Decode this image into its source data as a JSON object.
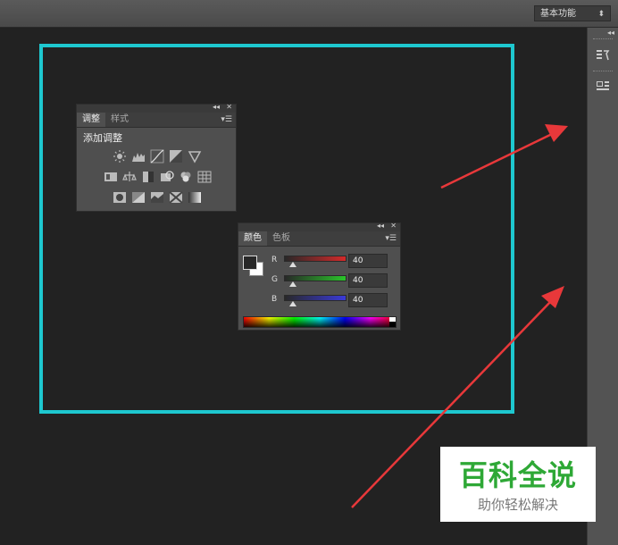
{
  "workspace": {
    "label": "基本功能",
    "arrow": "⬍"
  },
  "dock": {
    "collapse": "◂◂"
  },
  "adjustments_panel": {
    "titlebar_collapse": "◂◂",
    "titlebar_close": "✕",
    "tabs": [
      {
        "label": "调整"
      },
      {
        "label": "样式"
      }
    ],
    "menu": "▾☰",
    "add_label": "添加调整"
  },
  "color_panel": {
    "titlebar_collapse": "◂◂",
    "titlebar_close": "✕",
    "tabs": [
      {
        "label": "颜色"
      },
      {
        "label": "色板"
      }
    ],
    "menu": "▾☰",
    "channels": [
      {
        "label": "R",
        "value": "40",
        "color": "#d42a2a"
      },
      {
        "label": "G",
        "value": "40",
        "color": "#2ac42a"
      },
      {
        "label": "B",
        "value": "40",
        "color": "#3a3ad8"
      }
    ],
    "foreground_color": "#282828",
    "background_color": "#ffffff"
  },
  "watermark": {
    "title": "百科全说",
    "subtitle": "助你轻松解决"
  },
  "colors": {
    "highlight_frame": "#1ec8d0",
    "arrow": "#e8383a",
    "watermark_green": "#2ea836"
  }
}
